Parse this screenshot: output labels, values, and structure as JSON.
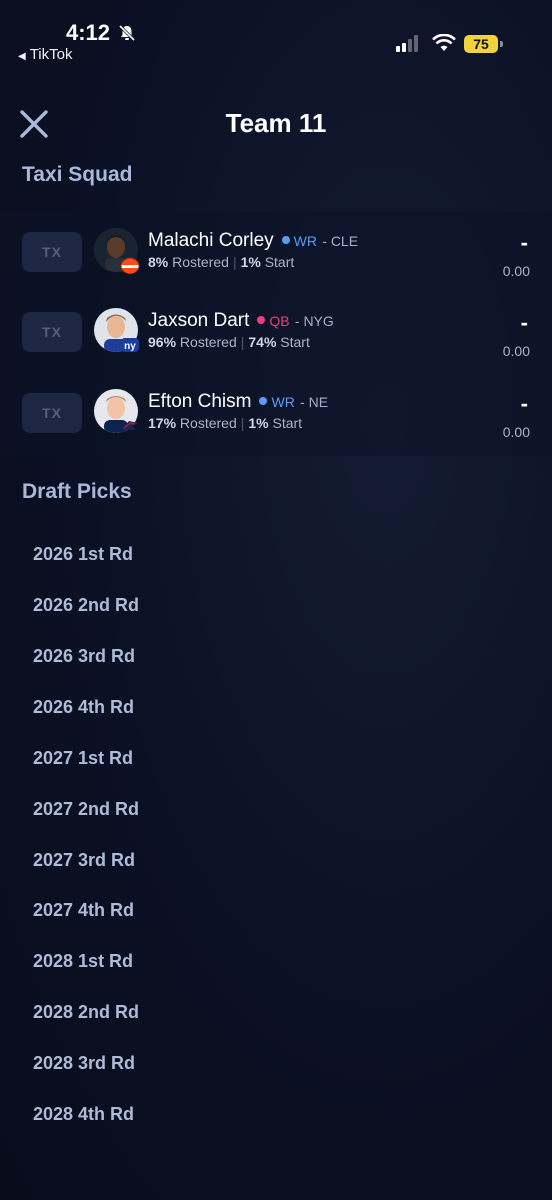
{
  "status_bar": {
    "time": "4:12",
    "back_app": "TikTok",
    "battery": "75"
  },
  "header": {
    "title": "Team 11"
  },
  "taxi_squad": {
    "title": "Taxi Squad",
    "players": [
      {
        "badge": "TX",
        "name": "Malachi Corley",
        "position": "WR",
        "position_color": "#5b9cf5",
        "team": "- CLE",
        "rostered": "8%",
        "rostered_label": "Rostered",
        "start": "1%",
        "start_label": "Start",
        "score": "-",
        "points": "0.00"
      },
      {
        "badge": "TX",
        "name": "Jaxson Dart",
        "position": "QB",
        "position_color": "#e8407a",
        "team": "- NYG",
        "rostered": "96%",
        "rostered_label": "Rostered",
        "start": "74%",
        "start_label": "Start",
        "score": "-",
        "points": "0.00"
      },
      {
        "badge": "TX",
        "name": "Efton Chism",
        "position": "WR",
        "position_color": "#5b9cf5",
        "team": "- NE",
        "rostered": "17%",
        "rostered_label": "Rostered",
        "start": "1%",
        "start_label": "Start",
        "score": "-",
        "points": "0.00"
      }
    ]
  },
  "draft_picks": {
    "title": "Draft Picks",
    "items": [
      "2026 1st Rd",
      "2026 2nd Rd",
      "2026 3rd Rd",
      "2026 4th Rd",
      "2027 1st Rd",
      "2027 2nd Rd",
      "2027 3rd Rd",
      "2027 4th Rd",
      "2028 1st Rd",
      "2028 2nd Rd",
      "2028 3rd Rd",
      "2028 4th Rd"
    ]
  }
}
